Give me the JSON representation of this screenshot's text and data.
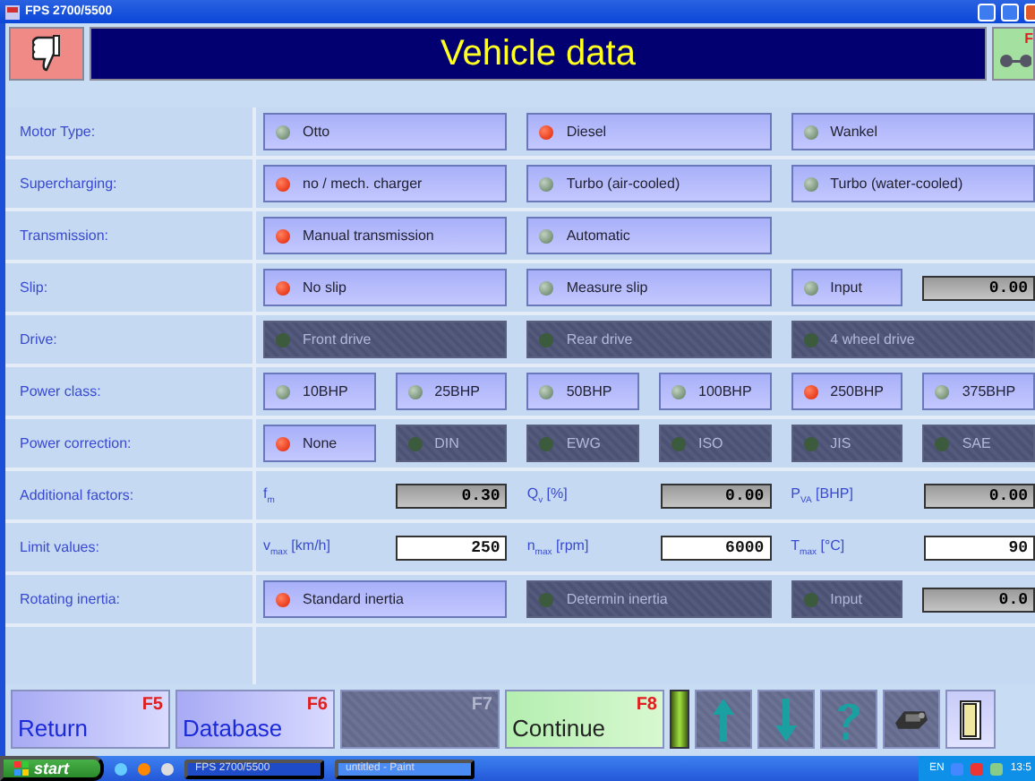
{
  "window": {
    "title": "FPS 2700/5500"
  },
  "header": {
    "title": "Vehicle data",
    "right_key": "F"
  },
  "rows": [
    {
      "label": "Motor Type:",
      "kind": "options",
      "items": [
        {
          "kind": "option",
          "label": "Otto",
          "selected": false,
          "disabled": false
        },
        {
          "kind": "option",
          "label": "Diesel",
          "selected": true,
          "disabled": false
        },
        {
          "kind": "option",
          "label": "Wankel",
          "selected": false,
          "disabled": false
        }
      ]
    },
    {
      "label": "Supercharging:",
      "kind": "options",
      "items": [
        {
          "kind": "option",
          "label": "no / mech. charger",
          "selected": true,
          "disabled": false
        },
        {
          "kind": "option",
          "label": "Turbo (air-cooled)",
          "selected": false,
          "disabled": false
        },
        {
          "kind": "option",
          "label": "Turbo (water-cooled)",
          "selected": false,
          "disabled": false
        }
      ]
    },
    {
      "label": "Transmission:",
      "kind": "options",
      "items": [
        {
          "kind": "option",
          "label": "Manual transmission",
          "selected": true,
          "disabled": false
        },
        {
          "kind": "option",
          "label": "Automatic",
          "selected": false,
          "disabled": false
        }
      ]
    },
    {
      "label": "Slip:",
      "kind": "options",
      "items": [
        {
          "kind": "option",
          "label": "No slip",
          "selected": true,
          "disabled": false
        },
        {
          "kind": "option",
          "label": "Measure slip",
          "selected": false,
          "disabled": false
        },
        {
          "kind": "option",
          "label": "Input",
          "selected": false,
          "disabled": false
        },
        {
          "kind": "field",
          "value": "0.00",
          "editable": false
        }
      ]
    },
    {
      "label": "Drive:",
      "kind": "options",
      "items": [
        {
          "kind": "option",
          "label": "Front drive",
          "selected": false,
          "disabled": true
        },
        {
          "kind": "option",
          "label": "Rear drive",
          "selected": false,
          "disabled": true
        },
        {
          "kind": "option",
          "label": "4 wheel drive",
          "selected": false,
          "disabled": true
        }
      ]
    },
    {
      "label": "Power class:",
      "kind": "options",
      "items": [
        {
          "kind": "option",
          "label": "10BHP",
          "selected": false,
          "disabled": false
        },
        {
          "kind": "option",
          "label": "25BHP",
          "selected": false,
          "disabled": false
        },
        {
          "kind": "option",
          "label": "50BHP",
          "selected": false,
          "disabled": false
        },
        {
          "kind": "option",
          "label": "100BHP",
          "selected": false,
          "disabled": false
        },
        {
          "kind": "option",
          "label": "250BHP",
          "selected": true,
          "disabled": false
        },
        {
          "kind": "option",
          "label": "375BHP",
          "selected": false,
          "disabled": false
        }
      ]
    },
    {
      "label": "Power correction:",
      "kind": "options",
      "items": [
        {
          "kind": "option",
          "label": "None",
          "selected": true,
          "disabled": false
        },
        {
          "kind": "option",
          "label": "DIN",
          "selected": false,
          "disabled": true
        },
        {
          "kind": "option",
          "label": "EWG",
          "selected": false,
          "disabled": true
        },
        {
          "kind": "option",
          "label": "ISO",
          "selected": false,
          "disabled": true
        },
        {
          "kind": "option",
          "label": "JIS",
          "selected": false,
          "disabled": true
        },
        {
          "kind": "option",
          "label": "SAE",
          "selected": false,
          "disabled": true
        }
      ]
    },
    {
      "label": "Additional factors:",
      "kind": "fields",
      "items": [
        {
          "label": "f$_{m}$",
          "value": "0.30",
          "editable": false
        },
        {
          "label": "Q$_{v}$ [%]",
          "value": "0.00",
          "editable": false
        },
        {
          "label": "P$_{VA}$ [BHP]",
          "value": "0.00",
          "editable": false
        }
      ]
    },
    {
      "label": "Limit values:",
      "kind": "fields",
      "items": [
        {
          "label": "v$_{max}$ [km/h]",
          "value": "250",
          "editable": true
        },
        {
          "label": "n$_{max}$ [rpm]",
          "value": "6000",
          "editable": true
        },
        {
          "label": "T$_{max}$ [°C]",
          "value": "90",
          "editable": true
        }
      ]
    },
    {
      "label": "Rotating inertia:",
      "kind": "options",
      "items": [
        {
          "kind": "option",
          "label": "Standard inertia",
          "selected": true,
          "disabled": false
        },
        {
          "kind": "option",
          "label": "Determin inertia",
          "selected": false,
          "disabled": true
        },
        {
          "kind": "option",
          "label": "Input",
          "selected": false,
          "disabled": true
        },
        {
          "kind": "field",
          "value": "0.0",
          "editable": false
        }
      ]
    }
  ],
  "function_keys": [
    {
      "label": "Return",
      "key": "F5",
      "kind": "normal"
    },
    {
      "label": "Database",
      "key": "F6",
      "kind": "normal"
    },
    {
      "key": "F7",
      "kind": "disabled"
    },
    {
      "label": "Continue",
      "key": "F8",
      "kind": "go"
    }
  ],
  "taskbar": {
    "start": "start",
    "tasks": [
      {
        "label": "FPS 2700/5500",
        "selected": true
      },
      {
        "label": "untitled - Paint",
        "selected": false
      }
    ],
    "language": "EN",
    "clock": "13:5"
  }
}
